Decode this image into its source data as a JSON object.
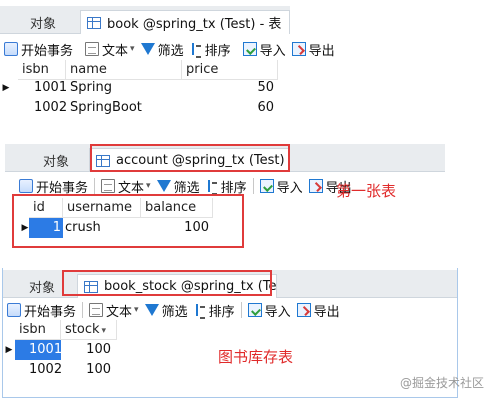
{
  "panel1": {
    "tabs": [
      {
        "label": "对象"
      },
      {
        "label": "book @spring_tx (Test) - 表"
      }
    ],
    "toolbar": {
      "begin_transaction": "开始事务",
      "text": "文本",
      "filter": "筛选",
      "sort": "排序",
      "import": "导入",
      "export": "导出"
    },
    "columns": [
      "isbn",
      "name",
      "price"
    ],
    "rows": [
      {
        "isbn": "1001",
        "name": "Spring",
        "price": "50"
      },
      {
        "isbn": "1002",
        "name": "SpringBoot",
        "price": "60"
      }
    ]
  },
  "panel2": {
    "tabs": [
      {
        "label": "对象"
      },
      {
        "label": "account @spring_tx (Test) -.."
      }
    ],
    "toolbar": {
      "begin_transaction": "开始事务",
      "text": "文本",
      "filter": "筛选",
      "sort": "排序",
      "import": "导入",
      "export": "导出"
    },
    "columns": [
      "id",
      "username",
      "balance"
    ],
    "rows": [
      {
        "id": "1",
        "username": "crush",
        "balance": "100"
      }
    ],
    "annotation": "第一张表"
  },
  "panel3": {
    "tabs": [
      {
        "label": "对象"
      },
      {
        "label": "book_stock @spring_tx (Tes..."
      }
    ],
    "toolbar": {
      "begin_transaction": "开始事务",
      "text": "文本",
      "filter": "筛选",
      "sort": "排序",
      "import": "导入",
      "export": "导出"
    },
    "columns": [
      "isbn",
      "stock"
    ],
    "rows": [
      {
        "isbn": "1001",
        "stock": "100"
      },
      {
        "isbn": "1002",
        "stock": "100"
      }
    ],
    "annotation": "图书库存表"
  },
  "watermark": "@掘金技术社区",
  "colors": {
    "annotation_red": "#e02b2b",
    "selection_blue": "#2c7be5",
    "icon_blue": "#1f78d1"
  }
}
